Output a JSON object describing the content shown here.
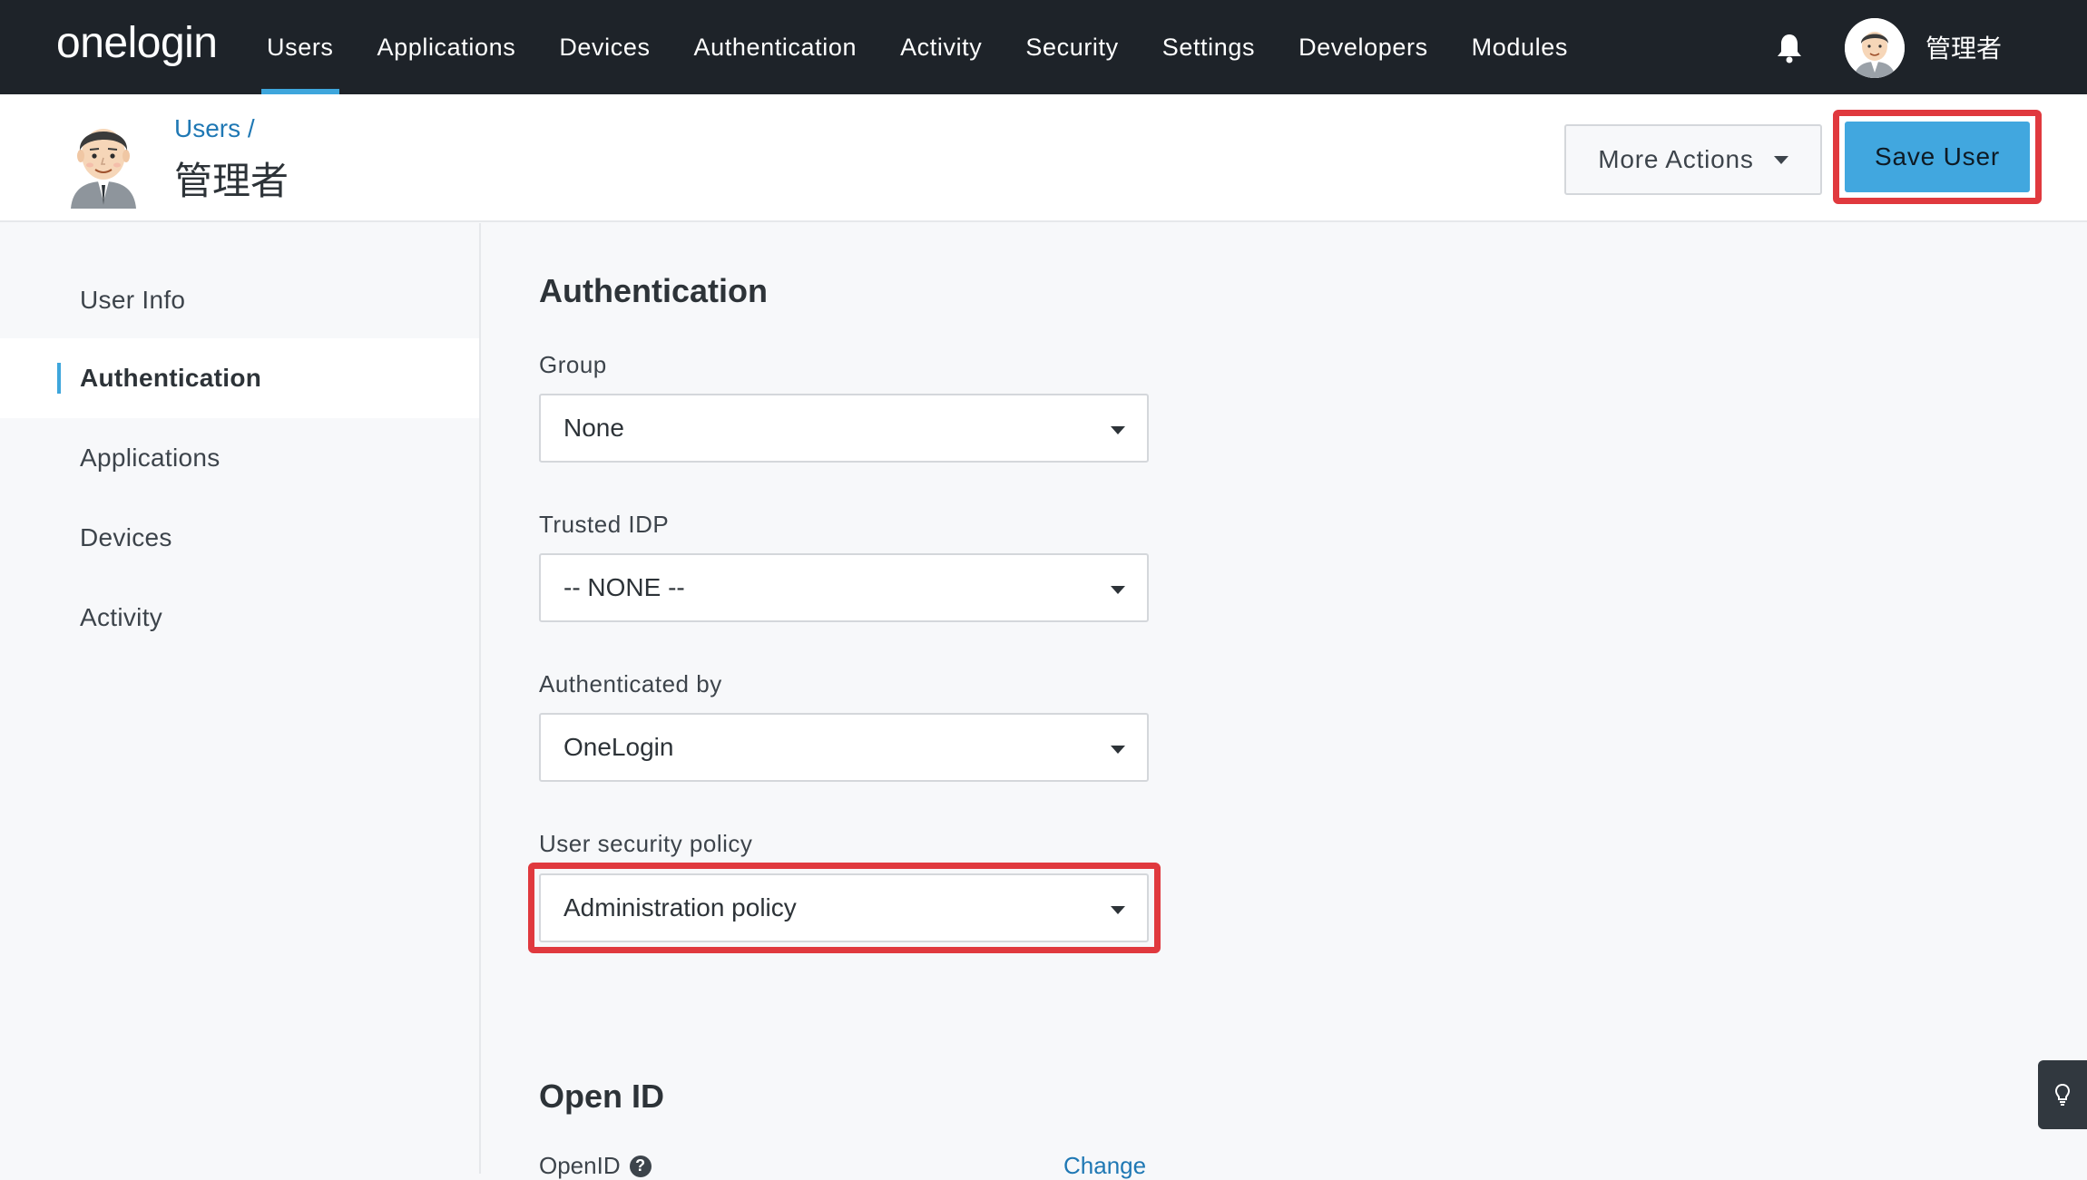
{
  "brand": {
    "logo_text": "onelogin"
  },
  "topnav": {
    "items": [
      {
        "label": "Users",
        "active": true
      },
      {
        "label": "Applications"
      },
      {
        "label": "Devices"
      },
      {
        "label": "Authentication"
      },
      {
        "label": "Activity"
      },
      {
        "label": "Security"
      },
      {
        "label": "Settings"
      },
      {
        "label": "Developers"
      },
      {
        "label": "Modules"
      }
    ],
    "notification_icon": "bell-icon",
    "username": "管理者"
  },
  "header": {
    "breadcrumb": "Users /",
    "title": "管理者",
    "more_actions_label": "More Actions",
    "save_label": "Save User"
  },
  "sidebar": {
    "items": [
      {
        "label": "User Info"
      },
      {
        "label": "Authentication",
        "active": true
      },
      {
        "label": "Applications"
      },
      {
        "label": "Devices"
      },
      {
        "label": "Activity"
      }
    ]
  },
  "main": {
    "section_title": "Authentication",
    "fields": [
      {
        "label": "Group",
        "value": "None"
      },
      {
        "label": "Trusted IDP",
        "value": "-- NONE --"
      },
      {
        "label": "Authenticated by",
        "value": "OneLogin"
      },
      {
        "label": "User security policy",
        "value": "Administration policy"
      }
    ],
    "openid_section_title": "Open ID",
    "openid_label": "OpenID",
    "change_label": "Change"
  },
  "colors": {
    "nav_bg": "#1e2329",
    "accent": "#41a7df",
    "highlight": "#e0393e",
    "link": "#1f78b4"
  }
}
